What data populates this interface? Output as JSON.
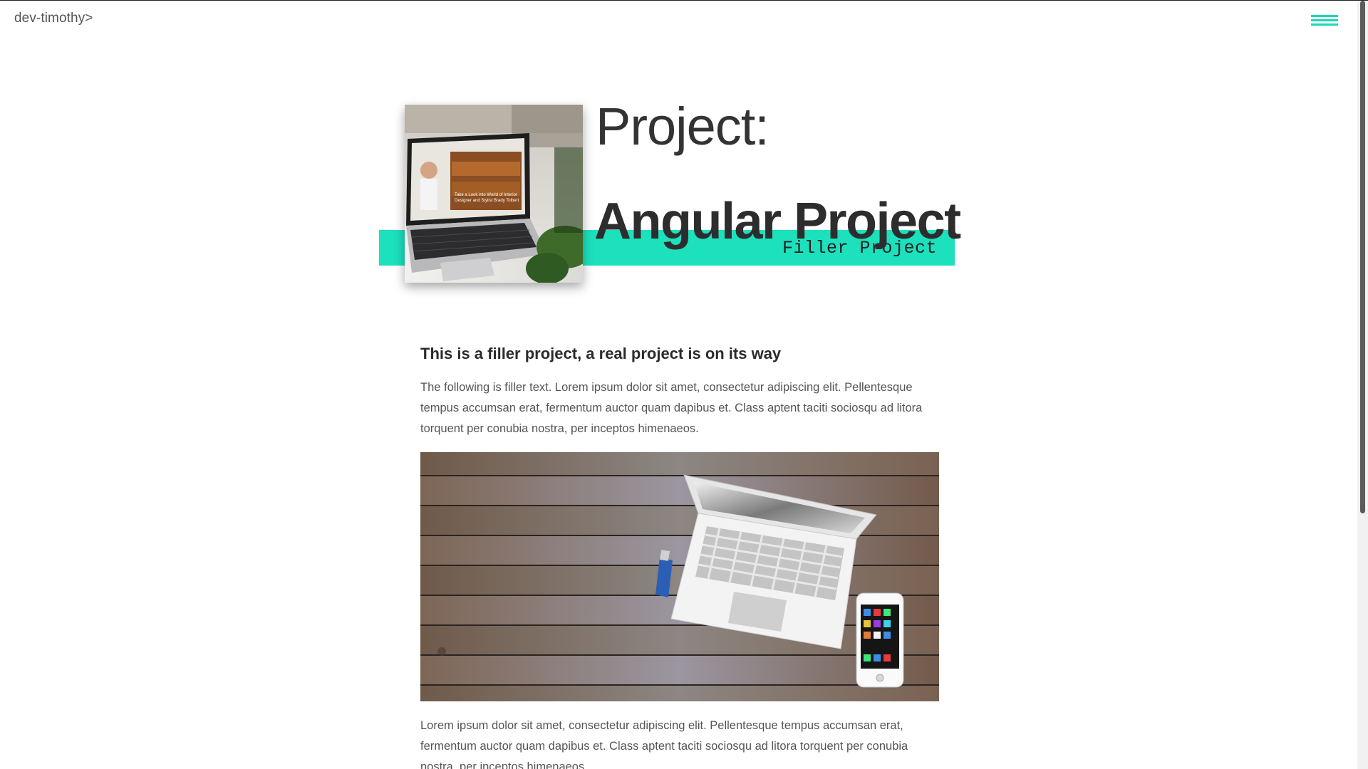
{
  "header": {
    "brand": "dev-timothy>",
    "menu_icon": "hamburger-icon",
    "accent_color": "#1de0bd"
  },
  "hero": {
    "title_line1": "Project:",
    "title_line2": "Angular Project",
    "tag": "Filler Project",
    "thumbnail_alt": "Laptop on a desk showing a website"
  },
  "article": {
    "heading": "This is a filler project, a real project is on its way",
    "paragraph1": "The following is filler text. Lorem ipsum dolor sit amet, consectetur adipiscing elit. Pellentesque tempus accumsan erat, fermentum auctor quam dapibus et. Class aptent taciti sociosqu ad litora torquent per conubia nostra, per inceptos himenaeos.",
    "image_alt": "Laptop, phone and USB stick on a wooden desk",
    "paragraph2": "Lorem ipsum dolor sit amet, consectetur adipiscing elit. Pellentesque tempus accumsan erat, fermentum auctor quam dapibus et. Class aptent taciti sociosqu ad litora torquent per conubia nostra, per inceptos himenaeos."
  }
}
